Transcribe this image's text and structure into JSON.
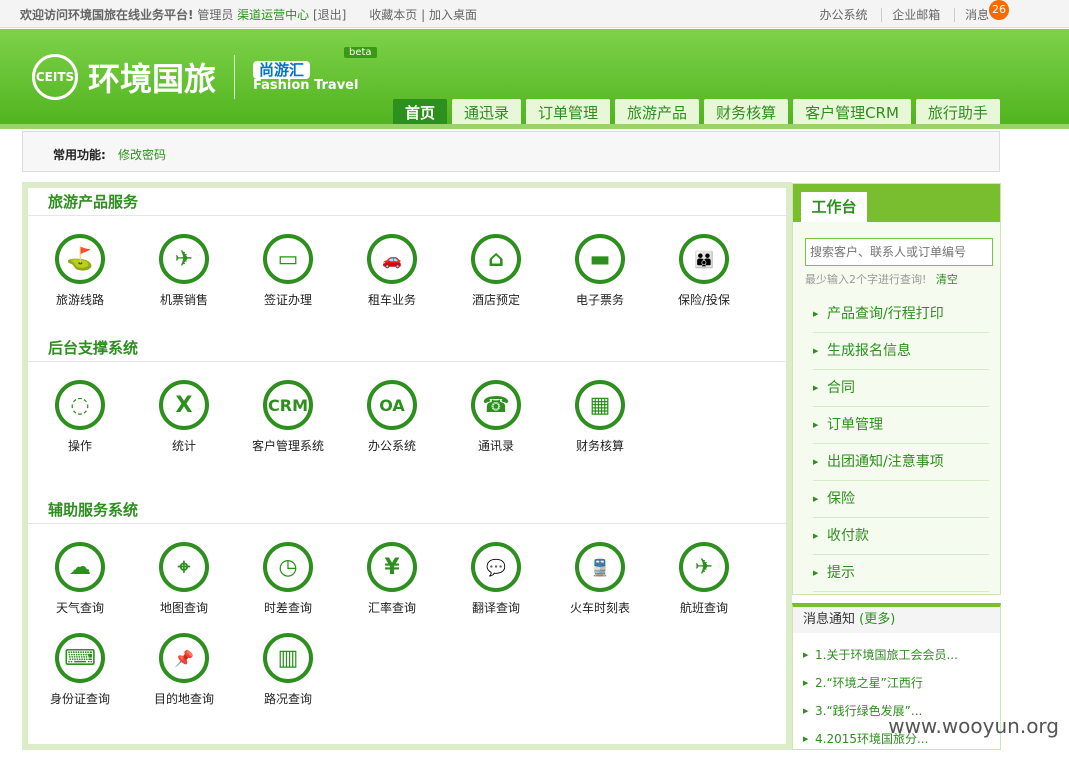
{
  "top": {
    "welcome": "欢迎访问环境国旅在线业务平台!",
    "role": "管理员",
    "channel": "渠道运营中心",
    "logout": "[退出]",
    "bookmark": "收藏本页",
    "desktop": "加入桌面",
    "office": "办公系统",
    "mail": "企业邮箱",
    "msg": "消息",
    "msg_count": "26"
  },
  "brand": {
    "name": "环境国旅",
    "seal_text": "CEITS",
    "secondary": "尚游汇",
    "secondary_en": "Fashion Travel",
    "beta": "beta"
  },
  "nav": [
    {
      "label": "首页"
    },
    {
      "label": "通迅录"
    },
    {
      "label": "订单管理"
    },
    {
      "label": "旅游产品"
    },
    {
      "label": "财务核算"
    },
    {
      "label": "客户管理CRM"
    },
    {
      "label": "旅行助手"
    }
  ],
  "quick": {
    "label": "常用功能:",
    "link": "修改密码"
  },
  "sections": [
    {
      "title": "旅游产品服务",
      "items": [
        {
          "label": "旅游线路",
          "icon": "signpost-icon",
          "glyph": "⛳"
        },
        {
          "label": "机票销售",
          "icon": "plane-icon",
          "glyph": "✈"
        },
        {
          "label": "签证办理",
          "icon": "card-icon",
          "glyph": "▭"
        },
        {
          "label": "租车业务",
          "icon": "car-icon",
          "glyph": "🚗"
        },
        {
          "label": "酒店预定",
          "icon": "house-icon",
          "glyph": "⌂"
        },
        {
          "label": "电子票务",
          "icon": "ticket-icon",
          "glyph": "▬"
        },
        {
          "label": "保险/投保",
          "icon": "family-icon",
          "glyph": "👪"
        }
      ]
    },
    {
      "title": "后台支撑系统",
      "items": [
        {
          "label": "操作",
          "icon": "spinner-icon",
          "glyph": "◌"
        },
        {
          "label": "统计",
          "icon": "excel-icon",
          "glyph": "X"
        },
        {
          "label": "客户管理系统",
          "icon": "crm-icon",
          "glyph": "CRM"
        },
        {
          "label": "办公系统",
          "icon": "oa-icon",
          "glyph": "OA"
        },
        {
          "label": "通讯录",
          "icon": "phone-icon",
          "glyph": "☎"
        },
        {
          "label": "财务核算",
          "icon": "calculator-icon",
          "glyph": "▦"
        }
      ]
    },
    {
      "title": "辅助服务系统",
      "items": [
        {
          "label": "天气查询",
          "icon": "cloud-icon",
          "glyph": "☁"
        },
        {
          "label": "地图查询",
          "icon": "map-pin-icon",
          "glyph": "⌖"
        },
        {
          "label": "时差查询",
          "icon": "clock-icon",
          "glyph": "◷"
        },
        {
          "label": "汇率查询",
          "icon": "exchange-icon",
          "glyph": "¥"
        },
        {
          "label": "翻译查询",
          "icon": "speech-icon",
          "glyph": "💬"
        },
        {
          "label": "火车时刻表",
          "icon": "train-icon",
          "glyph": "🚆"
        },
        {
          "label": "航班查询",
          "icon": "flight-icon",
          "glyph": "✈"
        },
        {
          "label": "身份证查询",
          "icon": "keyboard-icon",
          "glyph": "⌨"
        },
        {
          "label": "目的地查询",
          "icon": "pushpin-icon",
          "glyph": "📌"
        },
        {
          "label": "路况查询",
          "icon": "road-icon",
          "glyph": "▥"
        }
      ]
    }
  ],
  "workbench": {
    "title": "工作台",
    "search_placeholder": "搜索客户、联系人或订单编号",
    "hint": "最少输入2个字进行查询!",
    "clear": "清空",
    "items": [
      "产品查询/行程打印",
      "生成报名信息",
      "合同",
      "订单管理",
      "出团通知/注意事项",
      "保险",
      "收付款",
      "提示"
    ]
  },
  "notice": {
    "title": "消息通知",
    "more": "(更多)",
    "items": [
      "1.关于环境国旅工会会员...",
      "2.“环境之星”江西行",
      "3.“践行绿色发展”...",
      "4.2015环境国旅分..."
    ]
  },
  "watermark": "www.wooyun.org",
  "colors": {
    "accent": "#2d8f1e",
    "header": "#6cc33a",
    "badge": "#f46b00"
  }
}
